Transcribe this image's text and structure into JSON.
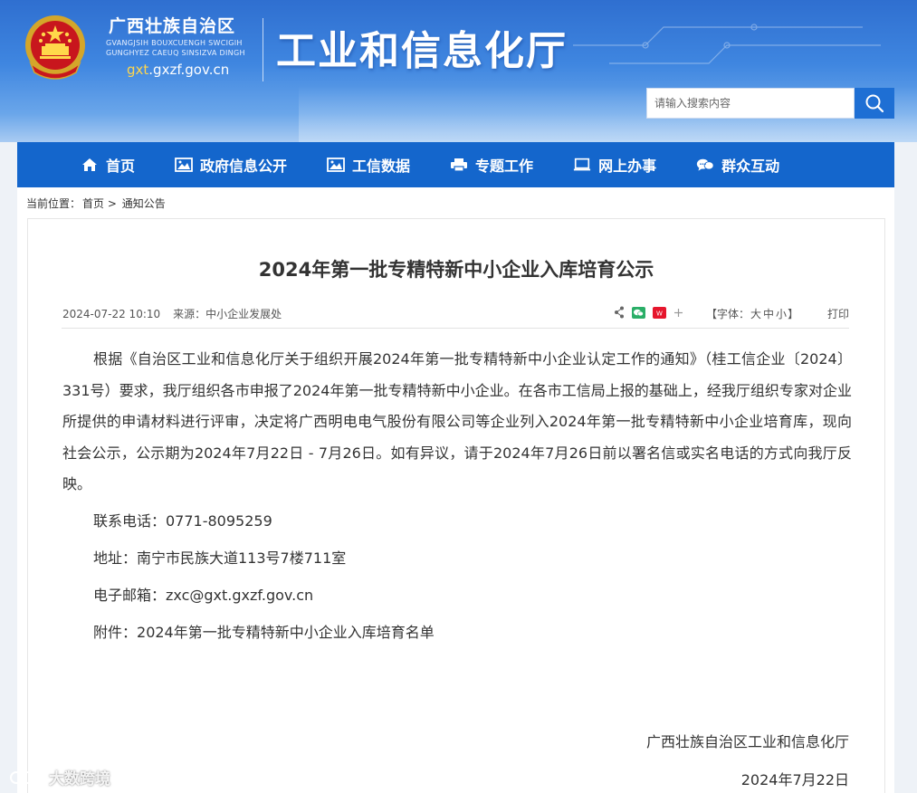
{
  "header": {
    "site_name": "广西壮族自治区",
    "site_name_zhuang_1": "GVANGJSIH BOUXCUENGH SWCIGIH",
    "site_name_zhuang_2": "GUNGHYEZ CAEUQ SINSIZVA DINGH",
    "site_url_prefix": "gxt",
    "site_url_suffix": ".gxzf.gov.cn",
    "dept_title": "工业和信息化厅"
  },
  "search": {
    "placeholder": "请输入搜索内容"
  },
  "nav": {
    "items": [
      {
        "label": "首页",
        "icon": "home-icon"
      },
      {
        "label": "政府信息公开",
        "icon": "picture-icon"
      },
      {
        "label": "工信数据",
        "icon": "picture-icon"
      },
      {
        "label": "专题工作",
        "icon": "printer-icon"
      },
      {
        "label": "网上办事",
        "icon": "laptop-icon"
      },
      {
        "label": "群众互动",
        "icon": "chat-icon"
      }
    ]
  },
  "breadcrumb": {
    "prefix": "当前位置：",
    "home": "首页",
    "sep": ">",
    "current": "通知公告"
  },
  "article": {
    "title": "2024年第一批专精特新中小企业入库培育公示",
    "date": "2024-07-22 10:10",
    "source": "来源：中小企业发展处",
    "font_ctl_prefix": "【字体：",
    "font_large": "大",
    "font_medium": "中",
    "font_small": "小",
    "font_ctl_suffix": "】",
    "print": "打印",
    "body": "根据《自治区工业和信息化厅关于组织开展2024年第一批专精特新中小企业认定工作的通知》（桂工信企业〔2024〕331号）要求，我厅组织各市申报了2024年第一批专精特新中小企业。在各市工信局上报的基础上，经我厅组织专家对企业所提供的申请材料进行评审，决定将广西明电电气股份有限公司等企业列入2024年第一批专精特新中小企业培育库，现向社会公示，公示期为2024年7月22日 - 7月26日。如有异议，请于2024年7月26日前以署名信或实名电话的方式向我厅反映。",
    "phone": "联系电话：0771-8095259",
    "address": "地址：南宁市民族大道113号7楼711室",
    "email": "电子邮箱：zxc@gxt.gxzf.gov.cn",
    "attachment_prefix": "附件：",
    "attachment_link": "2024年第一批专精特新中小企业入库培育名单",
    "sign_org": "广西壮族自治区工业和信息化厅",
    "sign_date": "2024年7月22日"
  },
  "watermark": "大数跨境",
  "colors": {
    "nav_bg": "#1466cc",
    "search_btn": "#1e6fd4",
    "url_accent": "#ffd64d"
  }
}
